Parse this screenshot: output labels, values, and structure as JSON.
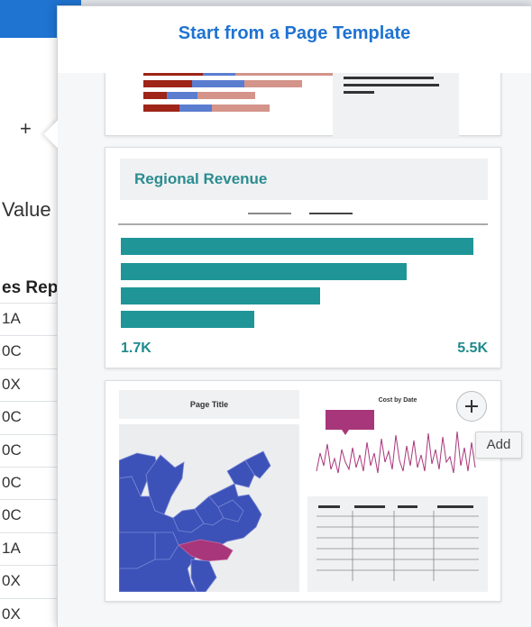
{
  "background": {
    "add_symbol": "+",
    "value_label": "Value",
    "column_header": "es Rep",
    "rows": [
      "1A",
      "0C",
      "0X",
      "0C",
      "0C",
      "0C",
      "0C",
      "1A",
      "0X",
      "0X"
    ]
  },
  "dialog": {
    "title": "Start from a Page Template"
  },
  "templates": [
    {
      "name": "stacked-bar-template"
    },
    {
      "name": "regional-revenue-template",
      "title": "Regional Revenue",
      "chart_data": {
        "type": "bar",
        "orientation": "horizontal",
        "values": [
          5.3,
          4.3,
          3.0,
          2.0
        ],
        "tick_labels": [
          "1.7K",
          "5.5K"
        ],
        "color": "#1f9598"
      }
    },
    {
      "name": "dashboard-template",
      "page_title": "Page Title",
      "chart_title": "Cost by Date",
      "highlight_color": "#a8367a",
      "map_color": "#3d52b8"
    }
  ],
  "add_button": {
    "icon": "plus-icon",
    "tooltip": "Add"
  }
}
